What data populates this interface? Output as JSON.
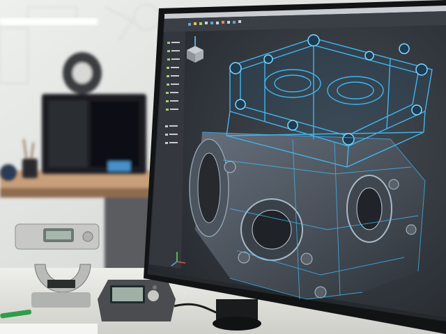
{
  "scene": {
    "description_tag": "cad-workstation-photo",
    "colors": {
      "wall": "#e6e7e5",
      "desk": "#eceae6",
      "shelf_wood": "#c9a27b",
      "monitor_bezel": "#151617",
      "screen_bg": "#2f3338",
      "wireframe": "#3fb6f0",
      "wireframe_glow": "#7fd8ff",
      "ui_panel": "#3a3d42",
      "printer": "#1d1f22"
    }
  },
  "cad_app": {
    "menu_items": [
      "",
      "",
      "",
      "",
      "",
      "",
      "",
      "",
      "",
      "",
      ""
    ]
  }
}
